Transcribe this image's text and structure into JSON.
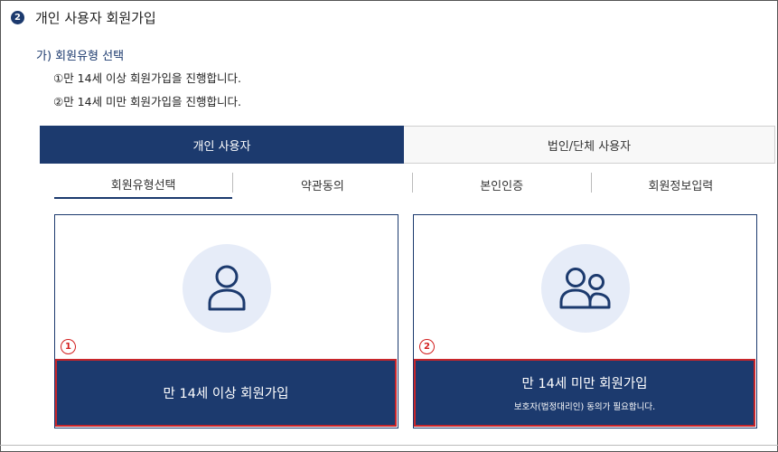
{
  "section": {
    "step_number": "2",
    "title": "개인 사용자 회원가입"
  },
  "subsection": {
    "title": "가) 회원유형 선택",
    "descriptions": [
      "①만 14세 이상 회원가입을 진행합니다.",
      "②만 14세 미만 회원가입을 진행합니다."
    ]
  },
  "user_tabs": [
    {
      "label": "개인 사용자",
      "active": true
    },
    {
      "label": "법인/단체 사용자",
      "active": false
    }
  ],
  "step_tabs": [
    {
      "label": "회원유형선택",
      "active": true
    },
    {
      "label": "약관동의",
      "active": false
    },
    {
      "label": "본인인증",
      "active": false
    },
    {
      "label": "회원정보입력",
      "active": false
    }
  ],
  "cards": [
    {
      "marker": "1",
      "icon": "person-icon",
      "button_title": "만 14세 이상 회원가입",
      "note": ""
    },
    {
      "marker": "2",
      "icon": "group-icon",
      "button_title": "만 14세 미만 회원가입",
      "note": "보호자(법정대리인) 동의가 필요합니다."
    }
  ],
  "colors": {
    "primary": "#1c3a6e",
    "icon_bg": "#e6ecf8",
    "highlight": "#d21d1d"
  }
}
